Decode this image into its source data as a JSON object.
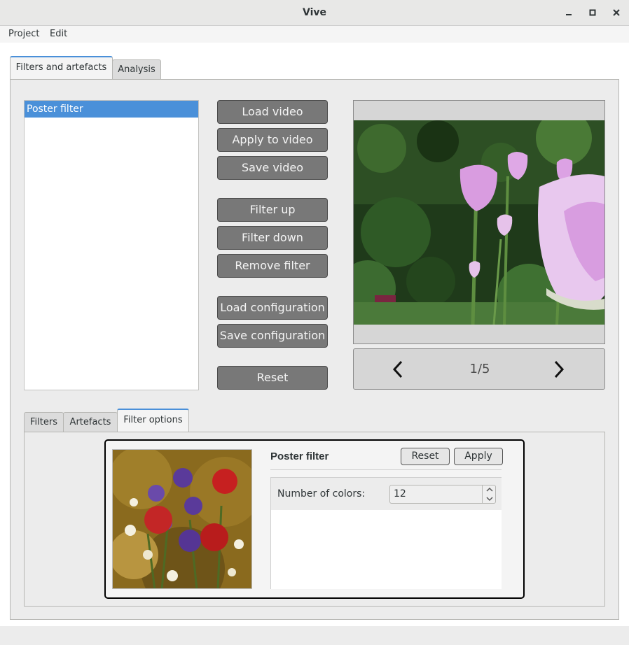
{
  "window": {
    "title": "Vive"
  },
  "menu": {
    "items": [
      "Project",
      "Edit"
    ]
  },
  "main_tabs": [
    "Filters and artefacts",
    "Analysis"
  ],
  "filter_list": [
    "Poster filter"
  ],
  "buttons": {
    "load_video": "Load video",
    "apply_to_video": "Apply to video",
    "save_video": "Save video",
    "filter_up": "Filter up",
    "filter_down": "Filter down",
    "remove_filter": "Remove filter",
    "load_configuration": "Load configuration",
    "save_configuration": "Save configuration",
    "reset": "Reset"
  },
  "preview": {
    "counter": "1/5",
    "prev_icon": "chevron-left-icon",
    "next_icon": "chevron-right-icon"
  },
  "bottom_tabs": [
    "Filters",
    "Artefacts",
    "Filter options"
  ],
  "filter_options": {
    "title": "Poster filter",
    "reset_label": "Reset",
    "apply_label": "Apply",
    "param_label": "Number of colors:",
    "param_value": "12"
  },
  "colors": {
    "accent": "#4a90d9",
    "button_bg": "#787878"
  }
}
